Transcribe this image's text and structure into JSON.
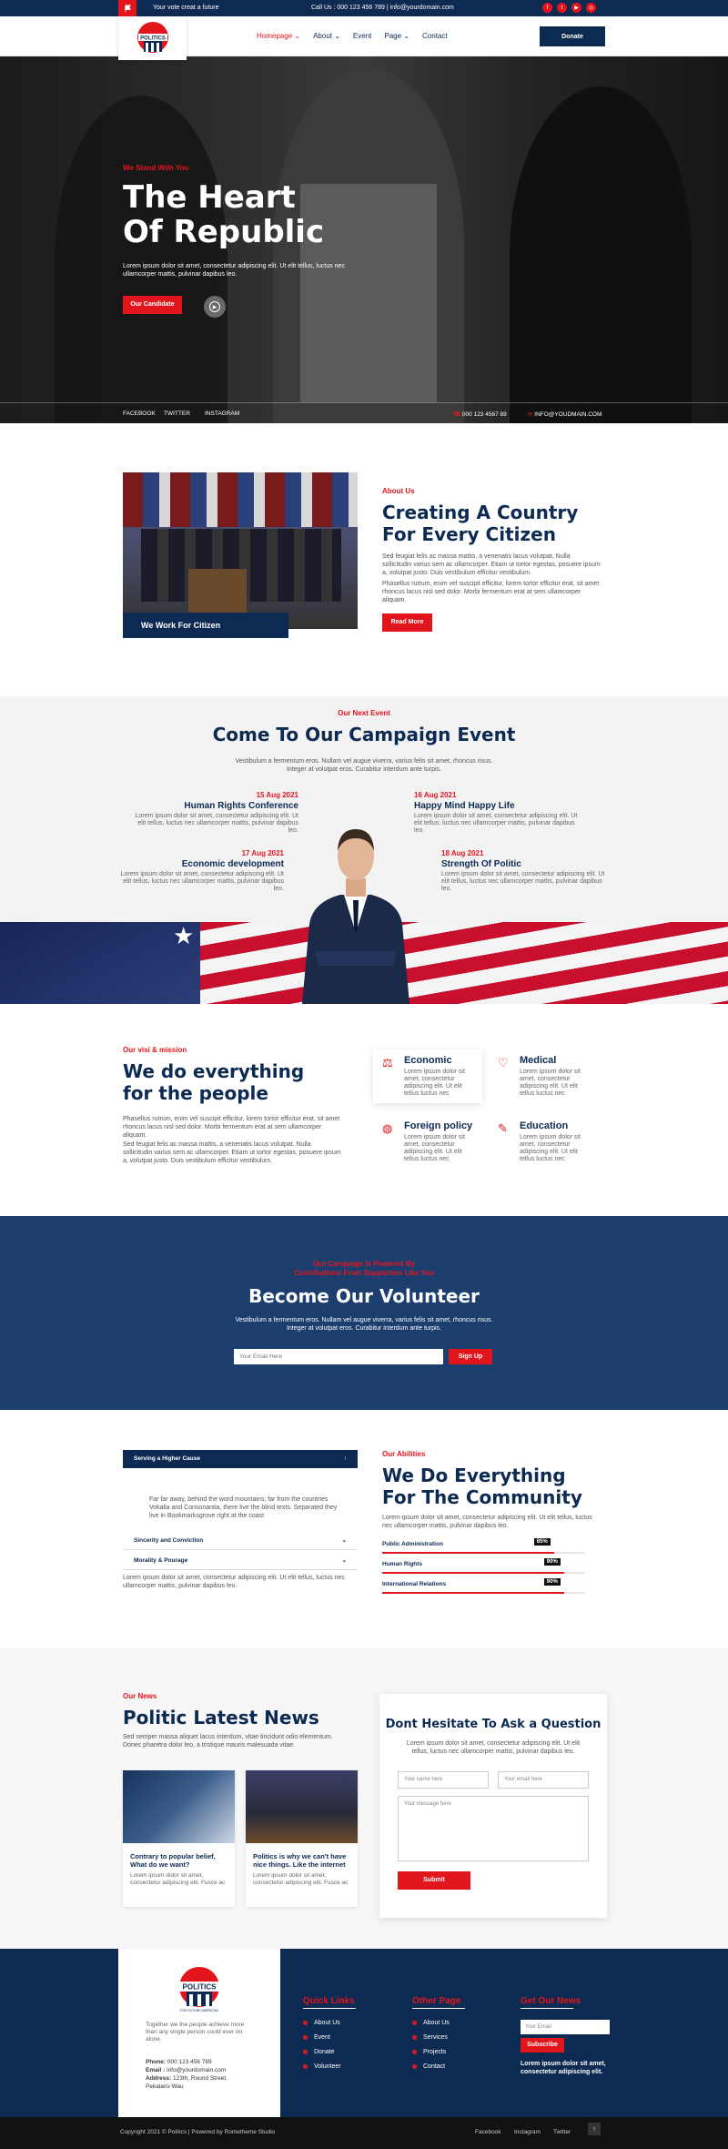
{
  "topbar": {
    "tagline": "Your vote creat a future",
    "contact": "Call Us : 000 123 456 789 | info@yourdomain.com",
    "socials": [
      "facebook-icon",
      "twitter-icon",
      "youtube-icon",
      "instagram-icon"
    ]
  },
  "header": {
    "logo_text": "POLITICS",
    "nav": [
      {
        "label": "Homepage",
        "caret": true
      },
      {
        "label": "About",
        "caret": true
      },
      {
        "label": "Event",
        "caret": false
      },
      {
        "label": "Page",
        "caret": true
      },
      {
        "label": "Contact",
        "caret": false
      }
    ],
    "donate": "Donate"
  },
  "hero": {
    "kicker": "We Stand With You",
    "title": "The Heart Of Republic",
    "lead": "Lorem ipsum dolor sit amet, consectetur adipiscing elit. Ut elit tellus, luctus nec ullamcorper mattis, pulvinar dapibus leo.",
    "cta": "Our Candidate",
    "links": [
      "FACEBOOK",
      "TWITTER",
      "INSTAGRAM"
    ],
    "phone": "000 123 4567 89",
    "email": "INFO@YOUDMAIN.COM"
  },
  "about": {
    "image_caption": "We Work For Citizen",
    "kicker": "About Us",
    "title": "Creating A Country For Every Citizen",
    "p1": "Sed feugiat felis ac massa mattis, a venenatis lacus volutpat. Nulla sollicitudin varius sem ac ullamcorper. Etiam ut tortor egestas, posuere ipsum a, volutpat justo. Duis vestibulum efficitur vestibulum.",
    "p2": "Phasellus rutrum, enim vel suscipit efficitur, lorem tortor efficitur erat, sit amet rhoncus lacus nisl sed dolor. Morbi fermentum erat at sem ullamcorper aliquam.",
    "cta": "Read More"
  },
  "events": {
    "kicker": "Our Next Event",
    "title": "Come To Our Campaign Event",
    "subtitle": "Vestibulum a fermentum eros. Nullam vel augue viverra, varius felis sit amet, rhoncus risus. Integer at volutpat eros. Curabitur interdum ante turpis.",
    "items": [
      {
        "date": "15 Aug 2021",
        "title": "Human Rights Conference",
        "text": "Lorem ipsum dolor sit amet, consectetur adipiscing elit. Ut elit tellus, luctus nec ullamcorper mattis, pulvinar dapibus leo."
      },
      {
        "date": "16 Aug 2021",
        "title": "Happy Mind Happy Life",
        "text": "Lorem ipsum dolor sit amet, consectetur adipiscing elit. Ut elit tellus, luctus nec ullamcorper mattis, pulvinar dapibus leo."
      },
      {
        "date": "17 Aug 2021",
        "title": "Economic development",
        "text": "Lorem ipsum dolor sit amet, consectetur adipiscing elit. Ut elit tellus, luctus nec ullamcorper mattis, pulvinar dapibus leo."
      },
      {
        "date": "18 Aug 2021",
        "title": "Strength Of Politic",
        "text": "Lorem ipsum dolor sit amet, consectetur adipiscing elit. Ut elit tellus, luctus nec ullamcorper mattis, pulvinar dapibus leo."
      }
    ]
  },
  "mission": {
    "kicker": "Our visi & mission",
    "title": "We do everything for the people",
    "p1": "Phasellus rutrum, enim vel suscipit efficitur, lorem tortor efficitur erat, sit amet rhoncus lacus nisl sed dolor. Morbi fermentum erat at sem ullamcorper aliquam.",
    "p2": "Sed feugiat felis ac massa mattis, a venenatis lacus volutpat. Nulla sollicitudin varius sem ac ullamcorper. Etiam ut tortor egestas, posuere ipsum a, volutpat justo. Duis vestibulum efficitur vestibulum.",
    "items": [
      {
        "icon": "economic-icon",
        "title": "Economic",
        "text": "Lorem ipsum dolor sit amet, consectetur adipiscing elit. Ut elit tellus luctus nec"
      },
      {
        "icon": "medical-icon",
        "title": "Medical",
        "text": "Lorem ipsum dolor sit amet, consectetur adipiscing elit. Ut elit tellus luctus nec"
      },
      {
        "icon": "globe-icon",
        "title": "Foreign policy",
        "text": "Lorem ipsum dolor sit amet, consectetur adipiscing elit. Ut elit tellus luctus nec"
      },
      {
        "icon": "education-icon",
        "title": "Education",
        "text": "Lorem ipsum dolor sit amet, consectetur adipiscing elit. Ut elit tellus luctus nec"
      }
    ]
  },
  "volunteer": {
    "kicker": "Our Campaign Is Powered By Contributions From Supporters Like You",
    "title": "Become Our Volunteer",
    "subtitle": "Vestibulum a fermentum eros. Nullam vel augue viverra, varius felis sit amet, rhoncus risus. Integer at volutpat eros. Curabitur interdum ante turpis.",
    "email_placeholder": "Your Email Here",
    "cta": "Sign Up"
  },
  "abilities": {
    "accordion": [
      {
        "label": "Serving a Higher Cause",
        "open": true,
        "body": "Far far away, behind the word mountains, far from the countries Vokalia and Consonantia, there live the blind texts. Separated they live in Bookmarksgrove right at the coast"
      },
      {
        "label": "Sincerity and Conviction",
        "open": false
      },
      {
        "label": "Morality & Pourage",
        "open": false
      }
    ],
    "left_text": "Lorem ipsum dolor sit amet, consectetur adipiscing elit. Ut elit tellus, luctus nec ullamcorper mattis, pulvinar dapibus leo.",
    "kicker": "Our Abilities",
    "title": "We Do Everything For The Community",
    "text": "Lorem ipsum dolor sit amet, consectetur adipiscing elit. Ut elit tellus, luctus nec ullamcorper mattis, pulvinar dapibus leo.",
    "skills": [
      {
        "label": "Public Administration",
        "value": 85,
        "text": "85%"
      },
      {
        "label": "Human Rights",
        "value": 90,
        "text": "90%"
      },
      {
        "label": "International Relations",
        "value": 90,
        "text": "90%"
      }
    ]
  },
  "news": {
    "kicker": "Our News",
    "title": "Politic Latest News",
    "subtitle": "Sed semper massa aliquet lacus interdum, vitae tincidunt odio elementum. Donec pharetra dolor leo, a tristique mauris malesuada vitae.",
    "cards": [
      {
        "title": "Contrary to popular belief, What do we want?",
        "text": "Lorem ipsum dolor sit amet, consectetur adipiscing elit. Fusce ac"
      },
      {
        "title": "Politics is why we can't have nice things. Like the internet",
        "text": "Lorem ipsum dolor sit amet, consectetur adipiscing elit. Fusce ac"
      }
    ]
  },
  "form": {
    "title": "Dont Hesitate To Ask a Question",
    "subtitle": "Lorem ipsum dolor sit amet, consectetur adipiscing elit. Ut elit tellus, luctus nec ullamcorper mattis, pulvinar dapibus leo.",
    "name_placeholder": "Your name here",
    "email_placeholder": "Your email here",
    "message_placeholder": "Your message here",
    "cta": "Submit"
  },
  "footer": {
    "logo_text": "POLITICS",
    "logo_sub": "FOR FUTURE AMERICAN",
    "description": "Together we the people achieve more than any single person could ever do alone.",
    "phone_label": "Phone:",
    "phone": "000 123 456 789",
    "email_label": "Email :",
    "email": "info@yourdomain.com",
    "address_label": "Address:",
    "address": "123th, Round Street, Pekalaris Wau",
    "quick_links_title": "Quick Links",
    "quick_links": [
      "About Us",
      "Event",
      "Donate",
      "Volunteer"
    ],
    "other_title": "Other Page",
    "other_links": [
      "About Us",
      "Services",
      "Projects",
      "Contact"
    ],
    "news_title": "Get Our News",
    "news_placeholder": "Your Email",
    "news_cta": "Subscribe",
    "news_text": "Lorem ipsum dolor sit amet, consectetur adipiscing elit."
  },
  "bottom": {
    "copyright": "Copyright 2021 © Politics | Powered by Rometheme Studio",
    "links": [
      "Facebook",
      "Instagram",
      "Twitter"
    ]
  }
}
